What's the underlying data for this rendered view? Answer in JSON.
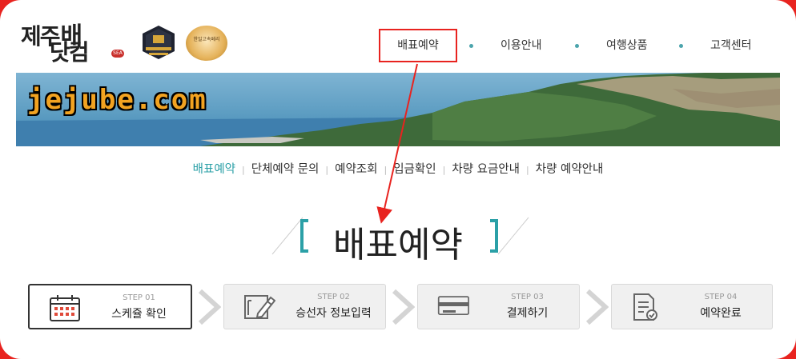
{
  "brand": {
    "logo_line1": "제주",
    "logo_line2": "닷컴",
    "logo_mark": "배",
    "logo_suffix": "SEA",
    "badge2_text": "한일고속페리"
  },
  "top_nav": {
    "items": [
      {
        "label": "배표예약",
        "active": true
      },
      {
        "label": "이용안내",
        "active": false
      },
      {
        "label": "여행상품",
        "active": false
      },
      {
        "label": "고객센터",
        "active": false
      }
    ]
  },
  "banner": {
    "site_text": "jejube.com"
  },
  "sub_nav": {
    "items": [
      {
        "label": "배표예약",
        "active": true
      },
      {
        "label": "단체예약 문의",
        "active": false
      },
      {
        "label": "예약조회",
        "active": false
      },
      {
        "label": "입금확인",
        "active": false
      },
      {
        "label": "차량 요금안내",
        "active": false
      },
      {
        "label": "차량 예약안내",
        "active": false
      }
    ]
  },
  "page": {
    "title": "배표예약"
  },
  "steps": [
    {
      "step_label": "STEP 01",
      "name": "스케쥴 확인",
      "icon": "calendar-icon",
      "active": true
    },
    {
      "step_label": "STEP 02",
      "name": "승선자 정보입력",
      "icon": "form-edit-icon",
      "active": false
    },
    {
      "step_label": "STEP 03",
      "name": "결제하기",
      "icon": "credit-card-icon",
      "active": false
    },
    {
      "step_label": "STEP 04",
      "name": "예약완료",
      "icon": "document-check-icon",
      "active": false
    }
  ],
  "colors": {
    "accent": "#2ba0a7",
    "highlight": "#e8231f",
    "text": "#333333"
  }
}
